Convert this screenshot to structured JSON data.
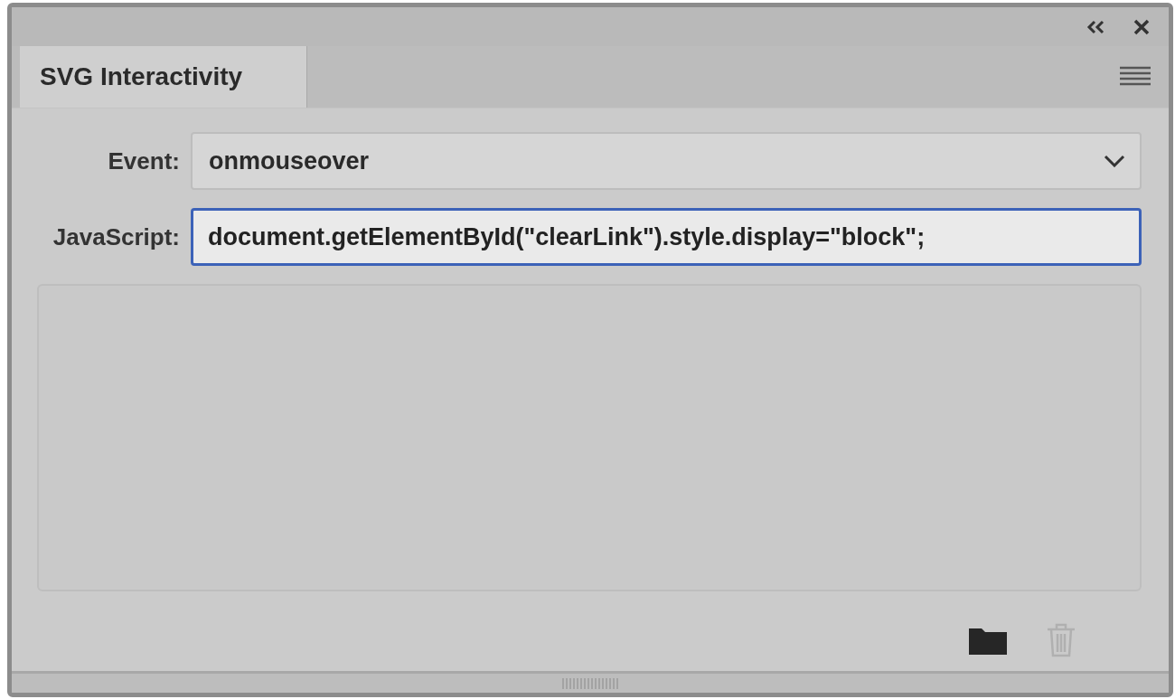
{
  "panel": {
    "tabs": [
      {
        "label": "SVG Interactivity",
        "selected": true
      }
    ]
  },
  "form": {
    "event": {
      "label": "Event:",
      "value": "onmouseover"
    },
    "javascript": {
      "label": "JavaScript:",
      "value": "document.getElementById(\"clearLink\").style.display=\"block\";",
      "focused": true
    }
  },
  "actions": [
    {
      "kind": "folder",
      "disabled": false
    },
    {
      "kind": "trash",
      "disabled": true
    }
  ]
}
